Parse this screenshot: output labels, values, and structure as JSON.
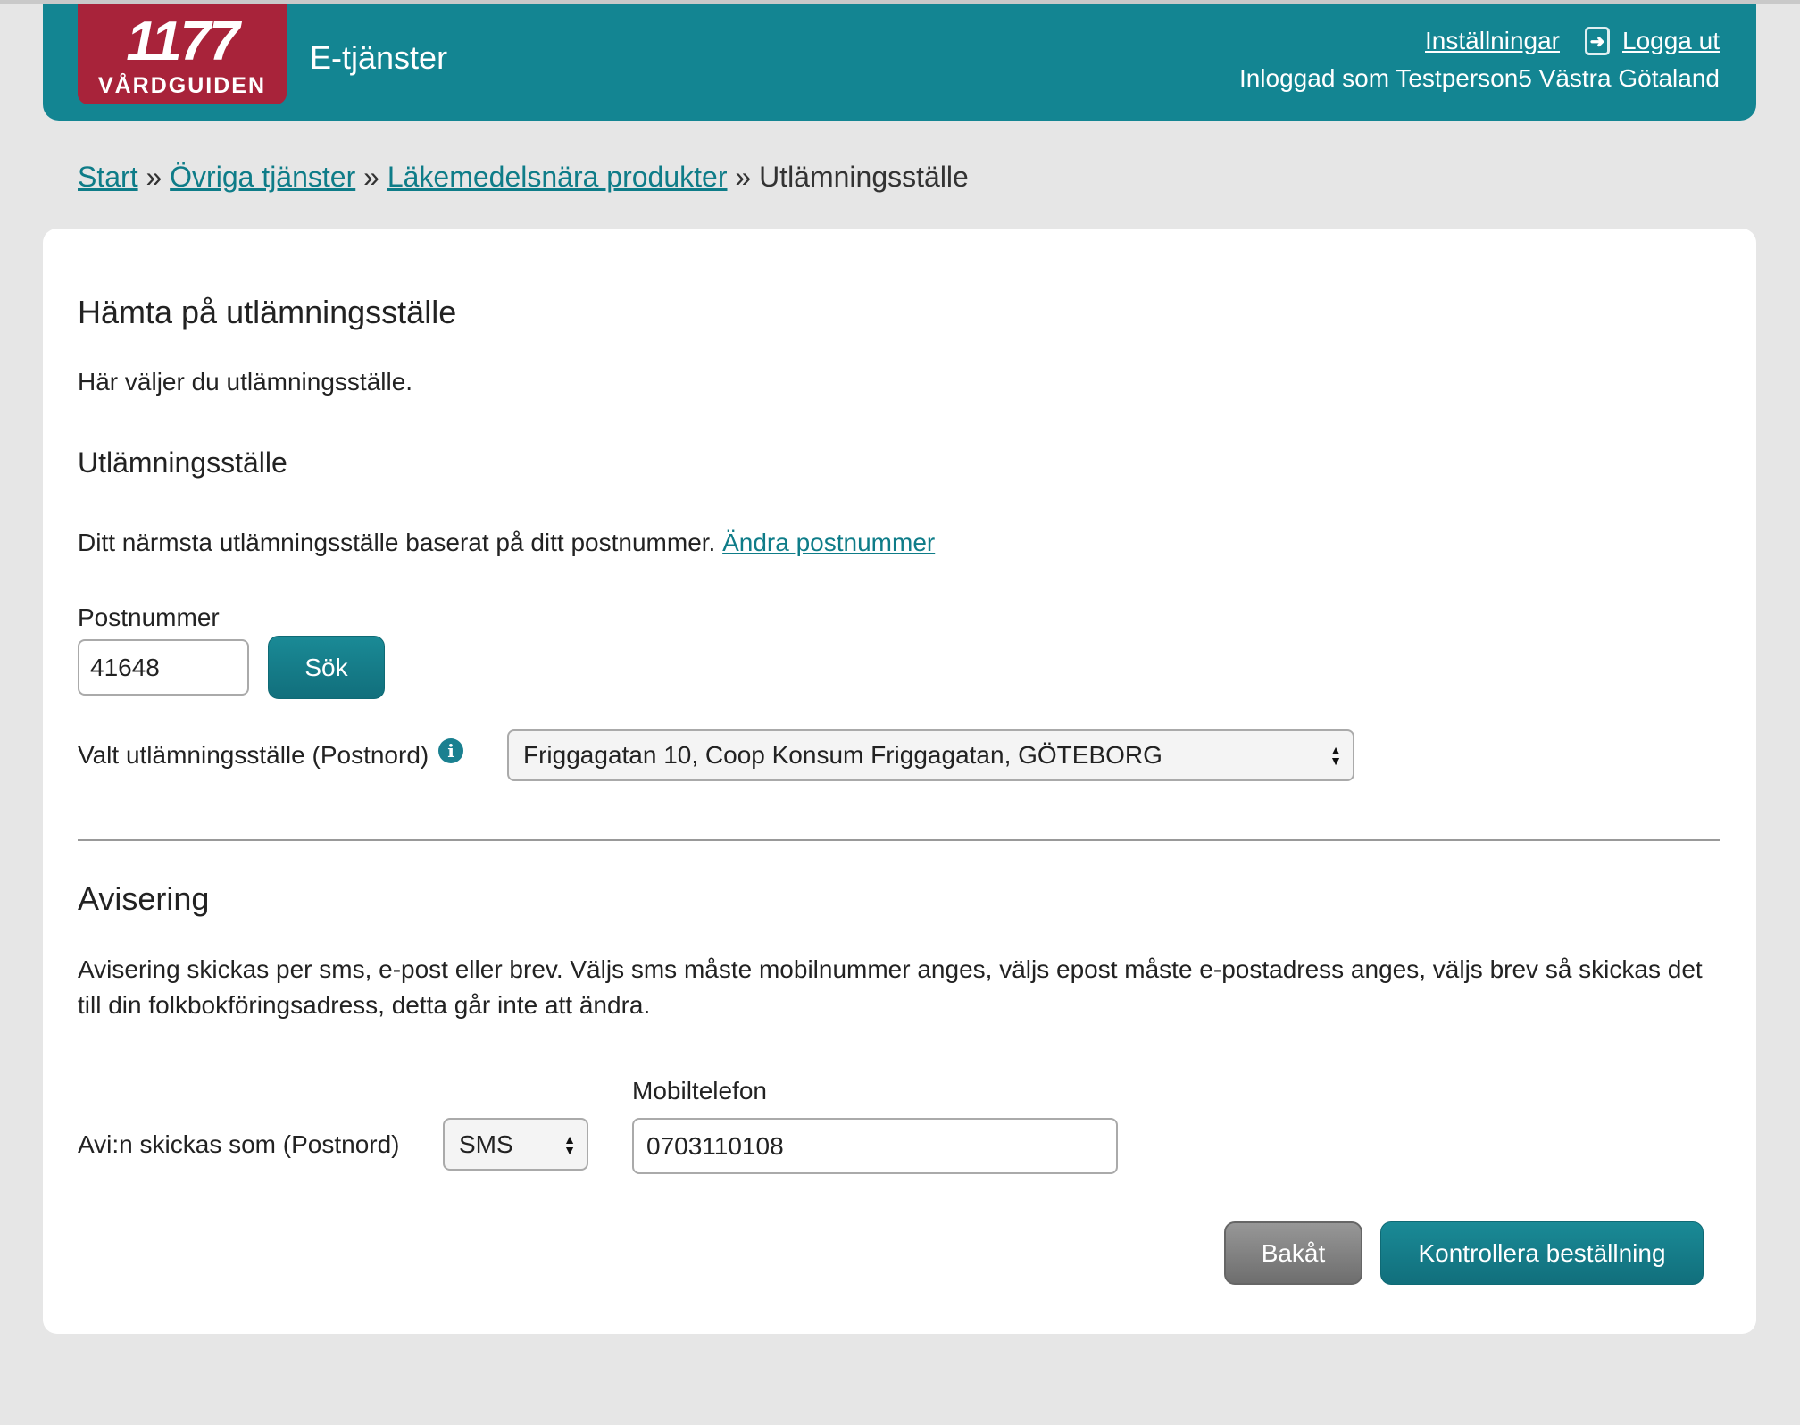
{
  "header": {
    "logo_number": "1177",
    "logo_text": "VÅRDGUIDEN",
    "title": "E-tjänster",
    "settings": "Inställningar",
    "logout": "Logga ut",
    "logged_in": "Inloggad som Testperson5 Västra Götaland"
  },
  "breadcrumb": [
    {
      "label": "Start"
    },
    {
      "label": "Övriga tjänster"
    },
    {
      "label": "Läkemedelsnära produkter"
    },
    {
      "label": "Utlämningsställe"
    }
  ],
  "breadcrumb_separator": "»",
  "main": {
    "title": "Hämta på utlämningsställe",
    "intro": "Här väljer du utlämningsställe.",
    "section_title": "Utlämningsställe",
    "nearest_text": "Ditt närmsta utlämningsställe baserat på ditt postnummer.",
    "change_postcode": "Ändra postnummer",
    "postcode_label": "Postnummer",
    "postcode_value": "41648",
    "search_button": "Sök",
    "pickup_label": "Valt utlämningsställe (Postnord)",
    "pickup_value": "Friggagatan 10, Coop Konsum Friggagatan, GÖTEBORG",
    "notice_title": "Avisering",
    "notice_text": "Avisering skickas per sms, e-post eller brev. Väljs sms måste mobilnummer anges, väljs epost måste e-postadress anges, väljs brev så skickas det till din folkbokföringsadress, detta går inte att ändra.",
    "notice_type_label": "Avi:n skickas som (Postnord)",
    "notice_type_value": "SMS",
    "mobile_label": "Mobiltelefon",
    "mobile_value": "0703110108",
    "back_button": "Bakåt",
    "submit_button": "Kontrollera beställning"
  },
  "colors": {
    "brand_teal": "#138592",
    "logo_red": "#a8233a",
    "background": "#e6e6e6"
  }
}
